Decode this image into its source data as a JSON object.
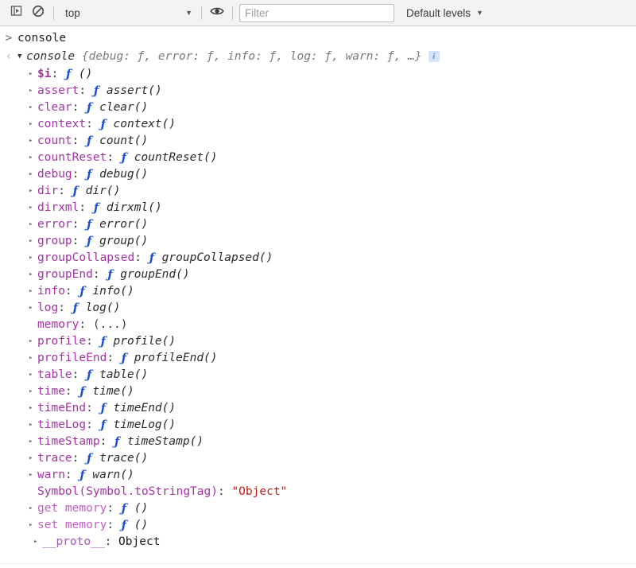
{
  "toolbar": {
    "console_sidebar_toggle": "console-sidebar-toggle",
    "clear_console": "clear-console",
    "context_selector": {
      "value": "top",
      "caret": "▼"
    },
    "live_expression": "create-live-expression",
    "filter": {
      "value": "",
      "placeholder": "Filter"
    },
    "levels": {
      "label": "Default levels",
      "caret": "▼"
    }
  },
  "console": {
    "prompt_marker": ">",
    "result_marker": "‹",
    "input_expression": "console",
    "result": {
      "expand_triangle": "▼",
      "title": "console",
      "preview": " {debug: ƒ, error: ƒ, info: ƒ, log: ƒ, warn: ƒ, …}",
      "info_badge": "i"
    },
    "properties": [
      {
        "arrow": "▸",
        "name": "$i",
        "kind": "own",
        "sep": ": ",
        "sigil": "ƒ",
        "value": " ()"
      },
      {
        "arrow": "▸",
        "name": "assert",
        "kind": "normal",
        "sep": ": ",
        "sigil": "ƒ",
        "value": " assert()"
      },
      {
        "arrow": "▸",
        "name": "clear",
        "kind": "normal",
        "sep": ": ",
        "sigil": "ƒ",
        "value": " clear()"
      },
      {
        "arrow": "▸",
        "name": "context",
        "kind": "normal",
        "sep": ": ",
        "sigil": "ƒ",
        "value": " context()"
      },
      {
        "arrow": "▸",
        "name": "count",
        "kind": "normal",
        "sep": ": ",
        "sigil": "ƒ",
        "value": " count()"
      },
      {
        "arrow": "▸",
        "name": "countReset",
        "kind": "normal",
        "sep": ": ",
        "sigil": "ƒ",
        "value": " countReset()"
      },
      {
        "arrow": "▸",
        "name": "debug",
        "kind": "normal",
        "sep": ": ",
        "sigil": "ƒ",
        "value": " debug()"
      },
      {
        "arrow": "▸",
        "name": "dir",
        "kind": "normal",
        "sep": ": ",
        "sigil": "ƒ",
        "value": " dir()"
      },
      {
        "arrow": "▸",
        "name": "dirxml",
        "kind": "normal",
        "sep": ": ",
        "sigil": "ƒ",
        "value": " dirxml()"
      },
      {
        "arrow": "▸",
        "name": "error",
        "kind": "normal",
        "sep": ": ",
        "sigil": "ƒ",
        "value": " error()"
      },
      {
        "arrow": "▸",
        "name": "group",
        "kind": "normal",
        "sep": ": ",
        "sigil": "ƒ",
        "value": " group()"
      },
      {
        "arrow": "▸",
        "name": "groupCollapsed",
        "kind": "normal",
        "sep": ": ",
        "sigil": "ƒ",
        "value": " groupCollapsed()"
      },
      {
        "arrow": "▸",
        "name": "groupEnd",
        "kind": "normal",
        "sep": ": ",
        "sigil": "ƒ",
        "value": " groupEnd()"
      },
      {
        "arrow": "▸",
        "name": "info",
        "kind": "normal",
        "sep": ": ",
        "sigil": "ƒ",
        "value": " info()"
      },
      {
        "arrow": "▸",
        "name": "log",
        "kind": "normal",
        "sep": ": ",
        "sigil": "ƒ",
        "value": " log()"
      },
      {
        "arrow": "",
        "name": "memory",
        "kind": "normal",
        "sep": ": ",
        "sigil": "",
        "value": "(...)",
        "value_style": "dim"
      },
      {
        "arrow": "▸",
        "name": "profile",
        "kind": "normal",
        "sep": ": ",
        "sigil": "ƒ",
        "value": " profile()"
      },
      {
        "arrow": "▸",
        "name": "profileEnd",
        "kind": "normal",
        "sep": ": ",
        "sigil": "ƒ",
        "value": " profileEnd()"
      },
      {
        "arrow": "▸",
        "name": "table",
        "kind": "normal",
        "sep": ": ",
        "sigil": "ƒ",
        "value": " table()"
      },
      {
        "arrow": "▸",
        "name": "time",
        "kind": "normal",
        "sep": ": ",
        "sigil": "ƒ",
        "value": " time()"
      },
      {
        "arrow": "▸",
        "name": "timeEnd",
        "kind": "normal",
        "sep": ": ",
        "sigil": "ƒ",
        "value": " timeEnd()"
      },
      {
        "arrow": "▸",
        "name": "timeLog",
        "kind": "normal",
        "sep": ": ",
        "sigil": "ƒ",
        "value": " timeLog()"
      },
      {
        "arrow": "▸",
        "name": "timeStamp",
        "kind": "normal",
        "sep": ": ",
        "sigil": "ƒ",
        "value": " timeStamp()"
      },
      {
        "arrow": "▸",
        "name": "trace",
        "kind": "normal",
        "sep": ": ",
        "sigil": "ƒ",
        "value": " trace()"
      },
      {
        "arrow": "▸",
        "name": "warn",
        "kind": "normal",
        "sep": ": ",
        "sigil": "ƒ",
        "value": " warn()"
      },
      {
        "arrow": "",
        "name": "Symbol(Symbol.toStringTag)",
        "kind": "normal",
        "sep": ": ",
        "sigil": "",
        "value": "\"Object\"",
        "value_style": "string"
      },
      {
        "arrow": "▸",
        "name": "get memory",
        "kind": "accessor",
        "sep": ": ",
        "sigil": "ƒ",
        "value": " ()"
      },
      {
        "arrow": "▸",
        "name": "set memory",
        "kind": "accessor",
        "sep": ": ",
        "sigil": "ƒ",
        "value": " ()"
      },
      {
        "arrow": "▸",
        "name": "__proto__",
        "kind": "proto",
        "sep": ": ",
        "sigil": "",
        "value": "Object",
        "value_style": "plain",
        "indent": "deep"
      }
    ]
  },
  "colors": {
    "property_name": "#a532a5",
    "accessor_name": "#c45ec4",
    "function_sigil": "#1a4fd6",
    "string_value": "#c41a16",
    "preview_text": "#7a7a7a",
    "toolbar_bg": "#f3f3f3",
    "info_badge_bg": "#d6e4fb"
  }
}
